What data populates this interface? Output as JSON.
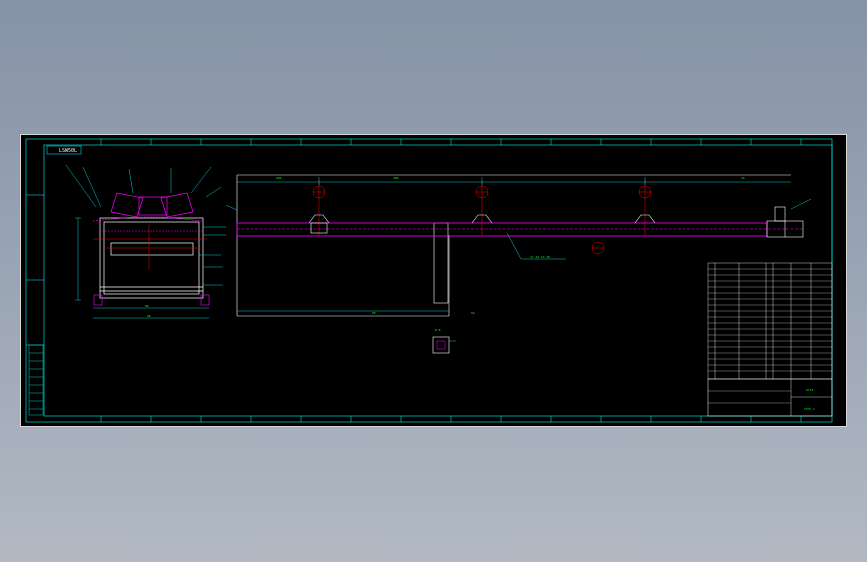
{
  "drawing": {
    "code_box": "LSW50L",
    "total_length": "500",
    "segment_dim": "400",
    "end_dim": "10",
    "section_label_note": "17 18 19 20",
    "detail_label": "B-B",
    "frame_dim_bottom": "88",
    "frame_dim_inner": "88",
    "leg_dim_left": "88",
    "leg_dim_right": "66",
    "title_block": {
      "name": "DTII",
      "number": "TD75-1"
    }
  },
  "icons": {
    "roller_symbol": "roller-circle-icon",
    "idler_symbol": "idler-support-icon"
  },
  "colors": {
    "background": "#000000",
    "frame": "#00ffff",
    "text": "#00ff00",
    "belt": "#ff00ff",
    "accent": "#ff0000",
    "outline": "#ffffff"
  }
}
